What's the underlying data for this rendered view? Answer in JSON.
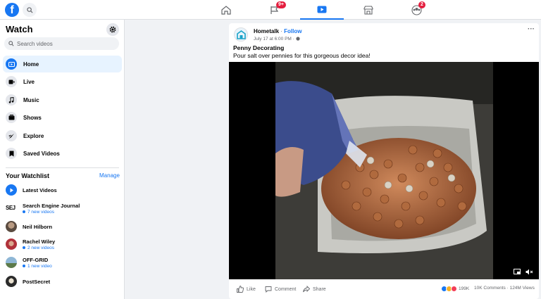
{
  "topbar": {
    "logo_letter": "f",
    "tabs": [
      {
        "name": "home"
      },
      {
        "name": "pages",
        "badge": "9+"
      },
      {
        "name": "watch",
        "active": true
      },
      {
        "name": "marketplace"
      },
      {
        "name": "groups",
        "badge": "2"
      }
    ],
    "colors": {
      "brand": "#1877f2",
      "badge": "#e41e3f"
    }
  },
  "sidebar": {
    "title": "Watch",
    "search_placeholder": "Search videos",
    "nav": [
      {
        "label": "Home",
        "icon": "watch-icon",
        "active": true
      },
      {
        "label": "Live",
        "icon": "live-icon"
      },
      {
        "label": "Music",
        "icon": "music-note-icon"
      },
      {
        "label": "Shows",
        "icon": "shows-icon"
      },
      {
        "label": "Explore",
        "icon": "rocket-icon"
      },
      {
        "label": "Saved Videos",
        "icon": "bookmark-icon"
      }
    ],
    "watchlist": {
      "title": "Your Watchlist",
      "manage": "Manage",
      "items": [
        {
          "name": "Latest Videos",
          "sub": ""
        },
        {
          "name": "Search Engine Journal",
          "sub": "7 new videos",
          "logo_text": "SEJ"
        },
        {
          "name": "Neil Hilborn",
          "sub": ""
        },
        {
          "name": "Rachel Wiley",
          "sub": "2 new videos"
        },
        {
          "name": "OFF-GRID",
          "sub": "1 new video"
        },
        {
          "name": "PostSecret",
          "sub": ""
        }
      ]
    }
  },
  "post": {
    "page_name": "Hometalk",
    "separator": " · ",
    "follow": "Follow",
    "time": "July 17 at 6:00 PM · ",
    "title": "Penny Decorating",
    "description": "Pour salt over pennies for this gorgeous decor idea!",
    "actions": {
      "like": "Like",
      "comment": "Comment",
      "share": "Share"
    },
    "reaction_count": "199K",
    "comments": "10K Comments",
    "views": "124M Views",
    "stats_separator": " · "
  }
}
